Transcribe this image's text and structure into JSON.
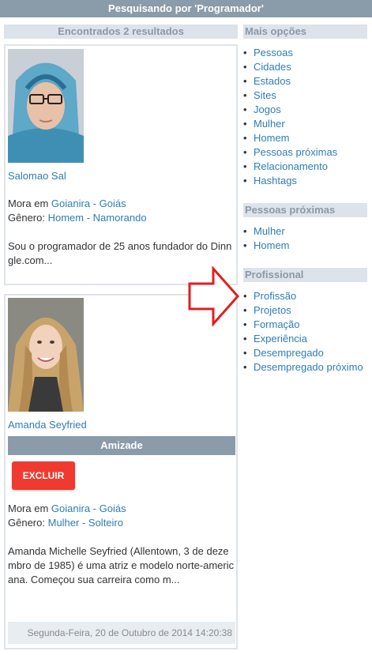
{
  "header": {
    "title": "Pesquisando por 'Programador'"
  },
  "results": {
    "count_label": "Encontrados 2 resultados",
    "people": [
      {
        "name": "Salomao Sal",
        "lives_prefix": "Mora em",
        "city": "Goianira - Goiás",
        "gender_prefix": "Gênero:",
        "gender_status": "Homem - Namorando",
        "bio": "Sou o programador de 25 anos fundador do Dinngle.com..."
      },
      {
        "name": "Amanda Seyfried",
        "friendship_label": "Amizade",
        "delete_label": "EXCLUIR",
        "lives_prefix": "Mora em",
        "city": "Goianira - Goiás",
        "gender_prefix": "Gênero:",
        "gender_status": "Mulher - Solteiro",
        "bio": "Amanda Michelle Seyfried (Allentown, 3 de dezembro de 1985) é uma atriz e modelo norte-americana. Começou sua carreira como m...",
        "date": "Segunda-Feira, 20 de Outubro de 2014 14:20:38"
      }
    ]
  },
  "sidebar": {
    "more_options": {
      "title": "Mais opções",
      "items": [
        "Pessoas",
        "Cidades",
        "Estados",
        "Sites",
        "Jogos",
        "Mulher",
        "Homem",
        "Pessoas próximas",
        "Relacionamento",
        "Hashtags"
      ]
    },
    "nearby": {
      "title": "Pessoas próximas",
      "items": [
        "Mulher",
        "Homem"
      ]
    },
    "professional": {
      "title": "Profissional",
      "items": [
        "Profissão",
        "Projetos",
        "Formação",
        "Experiência",
        "Desempregado",
        "Desempregado próximo"
      ]
    }
  },
  "colors": {
    "header_bg": "#8a9baa",
    "link": "#2e7db8",
    "delete_button": "#f03a2f",
    "arrow": "#e02020"
  }
}
